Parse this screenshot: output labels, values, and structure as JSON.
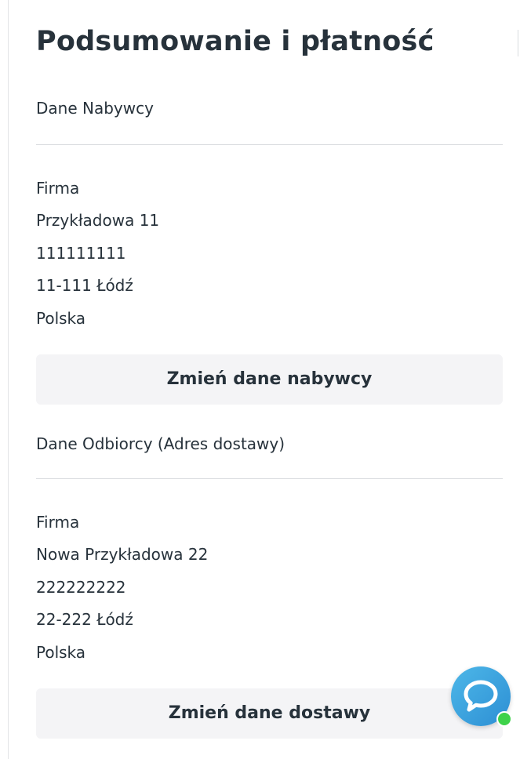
{
  "page_title": "Podsumowanie i płatność",
  "buyer": {
    "section_label": "Dane Nabywcy",
    "lines": [
      "Firma",
      "Przykładowa 11",
      "111111111",
      "11-111 Łódź",
      "Polska"
    ],
    "change_button_label": "Zmień dane nabywcy"
  },
  "recipient": {
    "section_label": "Dane Odbiorcy (Adres dostawy)",
    "lines": [
      "Firma",
      "Nowa Przykładowa 22",
      "222222222",
      "22-222 Łódź",
      "Polska"
    ],
    "change_button_label": "Zmień dane dostawy"
  },
  "chat_widget": {
    "icon": "chat-bubble-icon",
    "status": "online",
    "accent_color": "#3aa3e0",
    "status_color": "#3ed24a"
  }
}
